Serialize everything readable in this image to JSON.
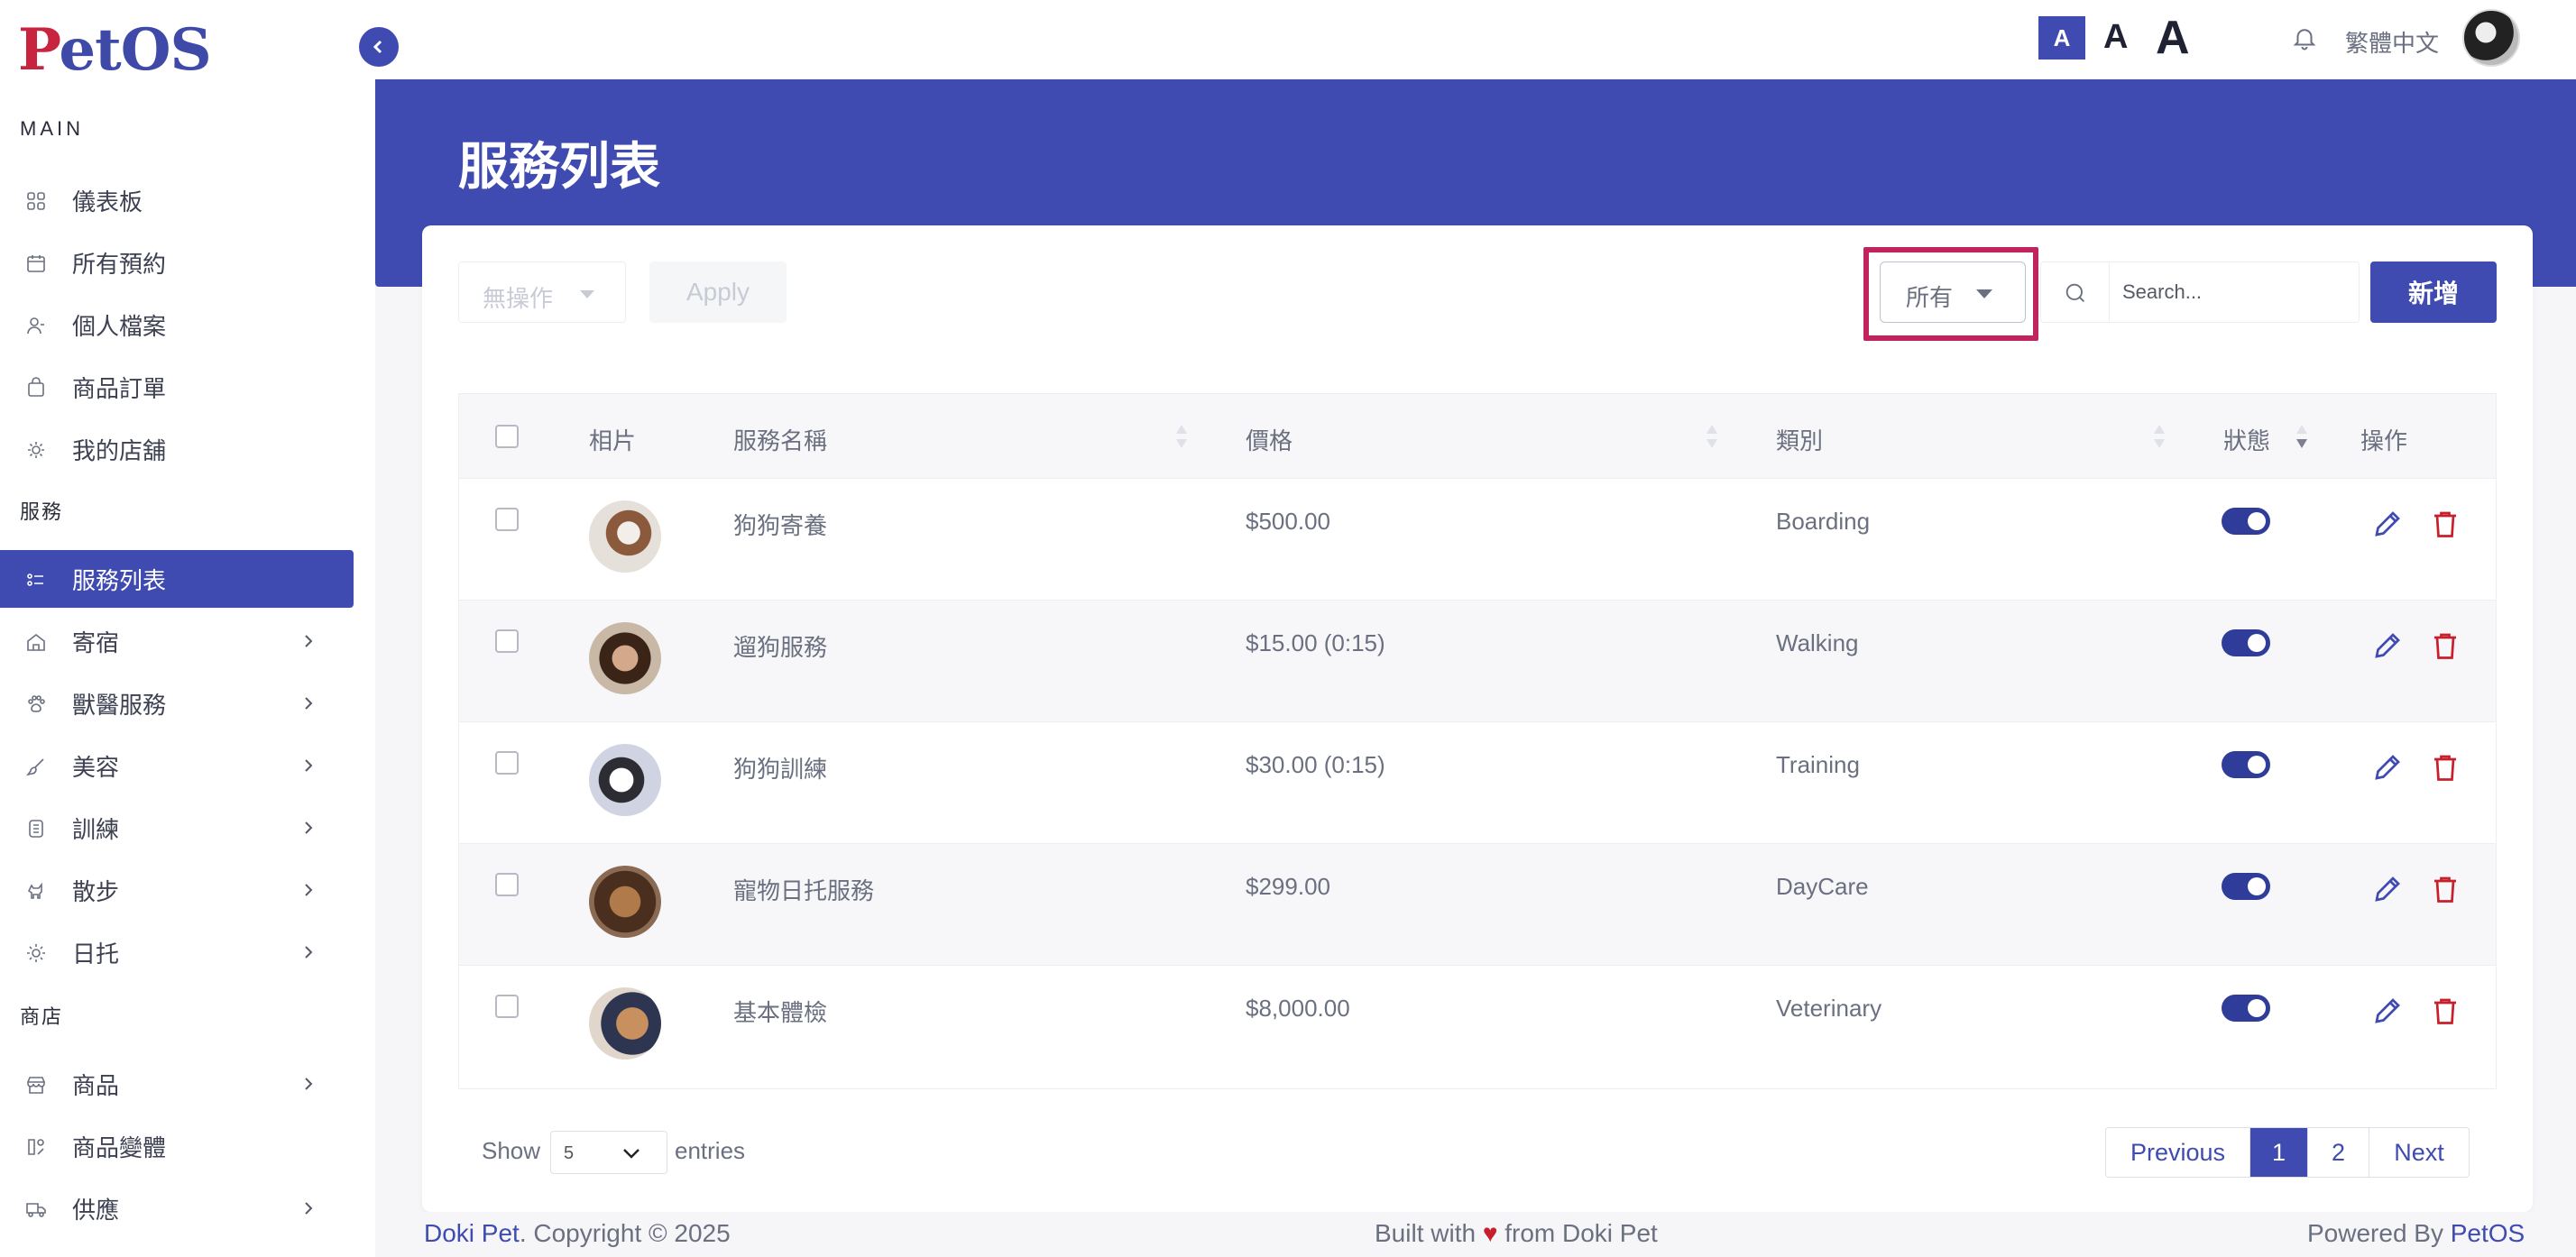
{
  "app": {
    "logo": "PetOS"
  },
  "sidebar": {
    "sections": [
      {
        "title": "MAIN"
      },
      {
        "title": "服務"
      },
      {
        "title": "商店"
      }
    ],
    "items": [
      {
        "label": "儀表板",
        "icon": "dashboard-icon"
      },
      {
        "label": "所有預約",
        "icon": "calendar-icon"
      },
      {
        "label": "個人檔案",
        "icon": "user-icon"
      },
      {
        "label": "商品訂單",
        "icon": "bag-icon"
      },
      {
        "label": "我的店舖",
        "icon": "shop-icon"
      },
      {
        "label": "服務列表",
        "icon": "list-icon",
        "active": true
      },
      {
        "label": "寄宿",
        "icon": "home-icon"
      },
      {
        "label": "獸醫服務",
        "icon": "paw-icon"
      },
      {
        "label": "美容",
        "icon": "brush-icon"
      },
      {
        "label": "訓練",
        "icon": "medal-icon"
      },
      {
        "label": "散步",
        "icon": "dog-icon"
      },
      {
        "label": "日托",
        "icon": "sun-icon"
      },
      {
        "label": "商品",
        "icon": "store-icon"
      },
      {
        "label": "商品變體",
        "icon": "shapes-icon"
      },
      {
        "label": "供應",
        "icon": "truck-icon"
      }
    ]
  },
  "topbar": {
    "font_small": "A",
    "font_mid": "A",
    "font_big": "A",
    "language": "繁體中文"
  },
  "page": {
    "title": "服務列表"
  },
  "toolbar": {
    "bulk_action": "無操作",
    "apply_label": "Apply",
    "filter_value": "所有",
    "search_placeholder": "Search...",
    "add_label": "新增"
  },
  "table": {
    "columns": [
      "相片",
      "服務名稱",
      "價格",
      "類別",
      "狀態",
      "操作"
    ],
    "rows": [
      {
        "name": "狗狗寄養",
        "price": "$500.00",
        "category": "Boarding",
        "enabled": true
      },
      {
        "name": "遛狗服務",
        "price": "$15.00 (0:15)",
        "category": "Walking",
        "enabled": true
      },
      {
        "name": "狗狗訓練",
        "price": "$30.00 (0:15)",
        "category": "Training",
        "enabled": true
      },
      {
        "name": "寵物日托服務",
        "price": "$299.00",
        "category": "DayCare",
        "enabled": true
      },
      {
        "name": "基本體檢",
        "price": "$8,000.00",
        "category": "Veterinary",
        "enabled": true
      }
    ]
  },
  "pagination": {
    "show_label": "Show",
    "entries_value": "5",
    "entries_label": "entries",
    "previous": "Previous",
    "pages": [
      "1",
      "2"
    ],
    "current": "1",
    "next": "Next"
  },
  "footer": {
    "left_brand": "Doki Pet",
    "left_text": ". Copyright © 2025",
    "mid_pre": "Built with",
    "mid_heart": "♥",
    "mid_post": "from Doki Pet",
    "right_pre": "Powered By",
    "right_brand": "PetOS"
  },
  "colors": {
    "primary": "#3f4bb1",
    "highlight": "#c0245e",
    "delete": "#c81f2c",
    "logo_red": "#c8233f"
  }
}
